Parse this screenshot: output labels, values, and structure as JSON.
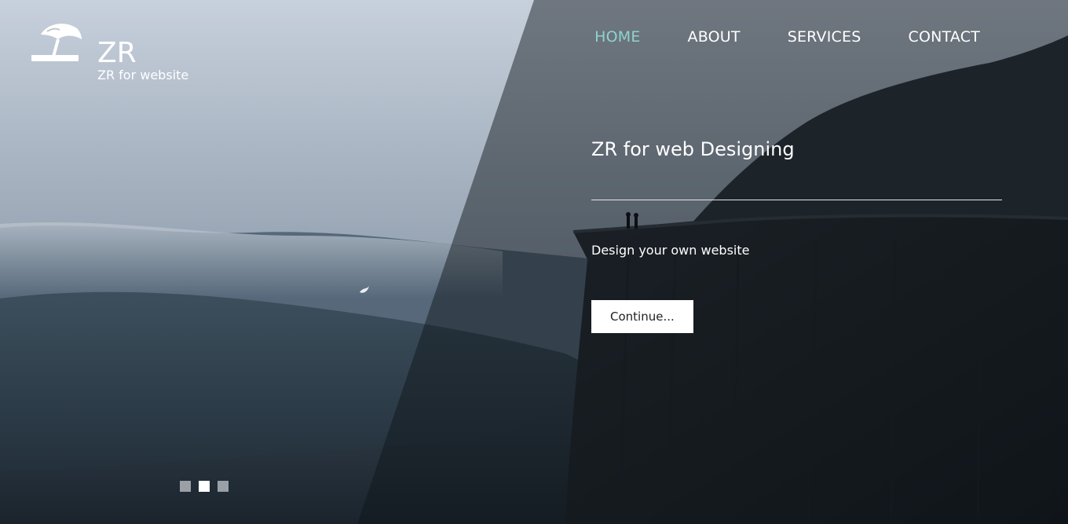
{
  "brand": {
    "icon": "beach-umbrella-icon",
    "title": "ZR",
    "subtitle": "ZR for website"
  },
  "nav": {
    "items": [
      {
        "label": "HOME",
        "active": true
      },
      {
        "label": "ABOUT",
        "active": false
      },
      {
        "label": "SERVICES",
        "active": false
      },
      {
        "label": "CONTACT",
        "active": false
      }
    ]
  },
  "hero": {
    "headline": "ZR for web Designing",
    "tagline": "Design your own website",
    "cta_label": "Continue..."
  },
  "slider": {
    "count": 3,
    "active_index": 1
  },
  "colors": {
    "nav_active": "#8ed3cf",
    "text": "#ffffff",
    "button_bg": "#ffffff",
    "dot_inactive": "#9aa0a6",
    "dot_active": "#ffffff"
  }
}
